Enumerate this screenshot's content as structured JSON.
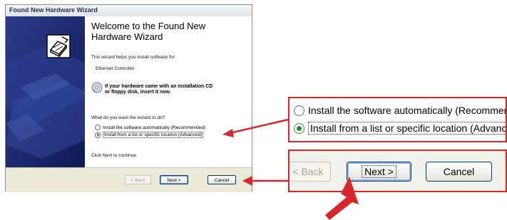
{
  "window": {
    "title": "Found New Hardware Wizard",
    "heading": "Welcome to the Found New Hardware Wizard",
    "intro": "This wizard helps you install software for:",
    "device": "Ethernet Controller",
    "cd_icon": "cd-disc-icon",
    "cd_hint_line1": "If your hardware came with an installation CD",
    "cd_hint_line2": "or floppy disk, insert it now.",
    "question": "What do you want the wizard to do?",
    "options": [
      {
        "label": "Install the software automatically (Recommended)",
        "selected": false
      },
      {
        "label": "Install from a list or specific location (Advanced)",
        "selected": true
      }
    ],
    "footer": "Click Next to continue.",
    "buttons": {
      "back": "< Back",
      "next": "Next >",
      "cancel": "Cancel"
    },
    "banner_icon": "hardware-wizard-icon"
  },
  "zoom_options": {
    "options": [
      {
        "label": "Install the software automatically (Recommende",
        "selected": false
      },
      {
        "label": "Install from a list or specific location (Advanced)",
        "selected": true
      }
    ]
  },
  "zoom_buttons": {
    "back": "< Back",
    "next": "Next >",
    "cancel": "Cancel"
  },
  "colors": {
    "highlight": "#d9262a",
    "banner": "#1e2e77",
    "radio_selected": "#1d9a1d"
  }
}
